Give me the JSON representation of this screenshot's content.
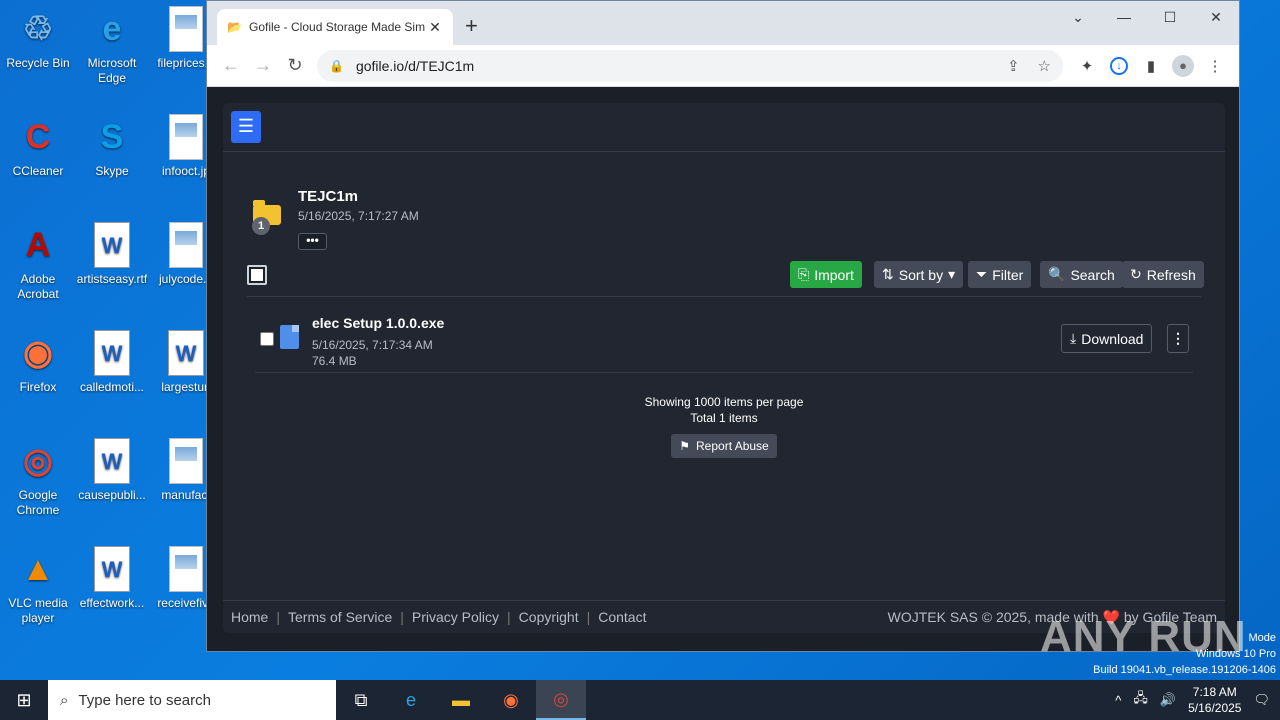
{
  "desktop": {
    "icons": [
      {
        "label": "Recycle Bin",
        "glyph": "♲",
        "color": "#7fb7e8"
      },
      {
        "label": "Microsoft Edge",
        "glyph": "e",
        "color": "#2aa1e5"
      },
      {
        "label": "fileprices.p",
        "glyph": "",
        "color": ""
      },
      {
        "label": "CCleaner",
        "glyph": "C",
        "color": "#d9322b"
      },
      {
        "label": "Skype",
        "glyph": "S",
        "color": "#0d9ee8"
      },
      {
        "label": "infooct.jp",
        "glyph": "",
        "color": ""
      },
      {
        "label": "Adobe Acrobat",
        "glyph": "A",
        "color": "#b30b00"
      },
      {
        "label": "artistseasy.rtf",
        "glyph": "W",
        "color": ""
      },
      {
        "label": "julycode.p",
        "glyph": "",
        "color": ""
      },
      {
        "label": "Firefox",
        "glyph": "◉",
        "color": "#ff7139"
      },
      {
        "label": "calledmoti...",
        "glyph": "W",
        "color": ""
      },
      {
        "label": "largestun",
        "glyph": "W",
        "color": ""
      },
      {
        "label": "Google Chrome",
        "glyph": "◎",
        "color": "#db4437"
      },
      {
        "label": "causepubli...",
        "glyph": "W",
        "color": ""
      },
      {
        "label": "manufact",
        "glyph": "",
        "color": ""
      },
      {
        "label": "VLC media player",
        "glyph": "▲",
        "color": "#f08a00"
      },
      {
        "label": "effectwork...",
        "glyph": "W",
        "color": ""
      },
      {
        "label": "receivefive",
        "glyph": "",
        "color": ""
      }
    ]
  },
  "browser": {
    "tab_title": "Gofile - Cloud Storage Made Sim",
    "url": "gofile.io/d/TEJC1m"
  },
  "folder": {
    "name": "TEJC1m",
    "date": "5/16/2025, 7:17:27 AM",
    "badge": "1",
    "more": "•••"
  },
  "toolbar": {
    "import": "Import",
    "sort": "Sort by",
    "filter": "Filter",
    "search": "Search",
    "refresh": "Refresh"
  },
  "files": [
    {
      "name": "elec Setup 1.0.0.exe",
      "date": "5/16/2025, 7:17:34 AM",
      "size": "76.4 MB",
      "download": "Download"
    }
  ],
  "pagination": {
    "per_page": "Showing 1000 items per page",
    "total": "Total 1 items",
    "report": "Report Abuse"
  },
  "footer": {
    "links": [
      "Home",
      "Terms of Service",
      "Privacy Policy",
      "Copyright",
      "Contact"
    ],
    "credit": "WOJTEK SAS © 2025, made with ❤️ by Gofile Team"
  },
  "taskbar": {
    "search_placeholder": "Type here to search",
    "time": "7:18 AM",
    "date": "5/16/2025"
  },
  "watermark": {
    "line1": "Mode",
    "line2": "Windows 10 Pro",
    "line3": "Build 19041.vb_release.191206-1406",
    "brand": "ANY RUN"
  }
}
